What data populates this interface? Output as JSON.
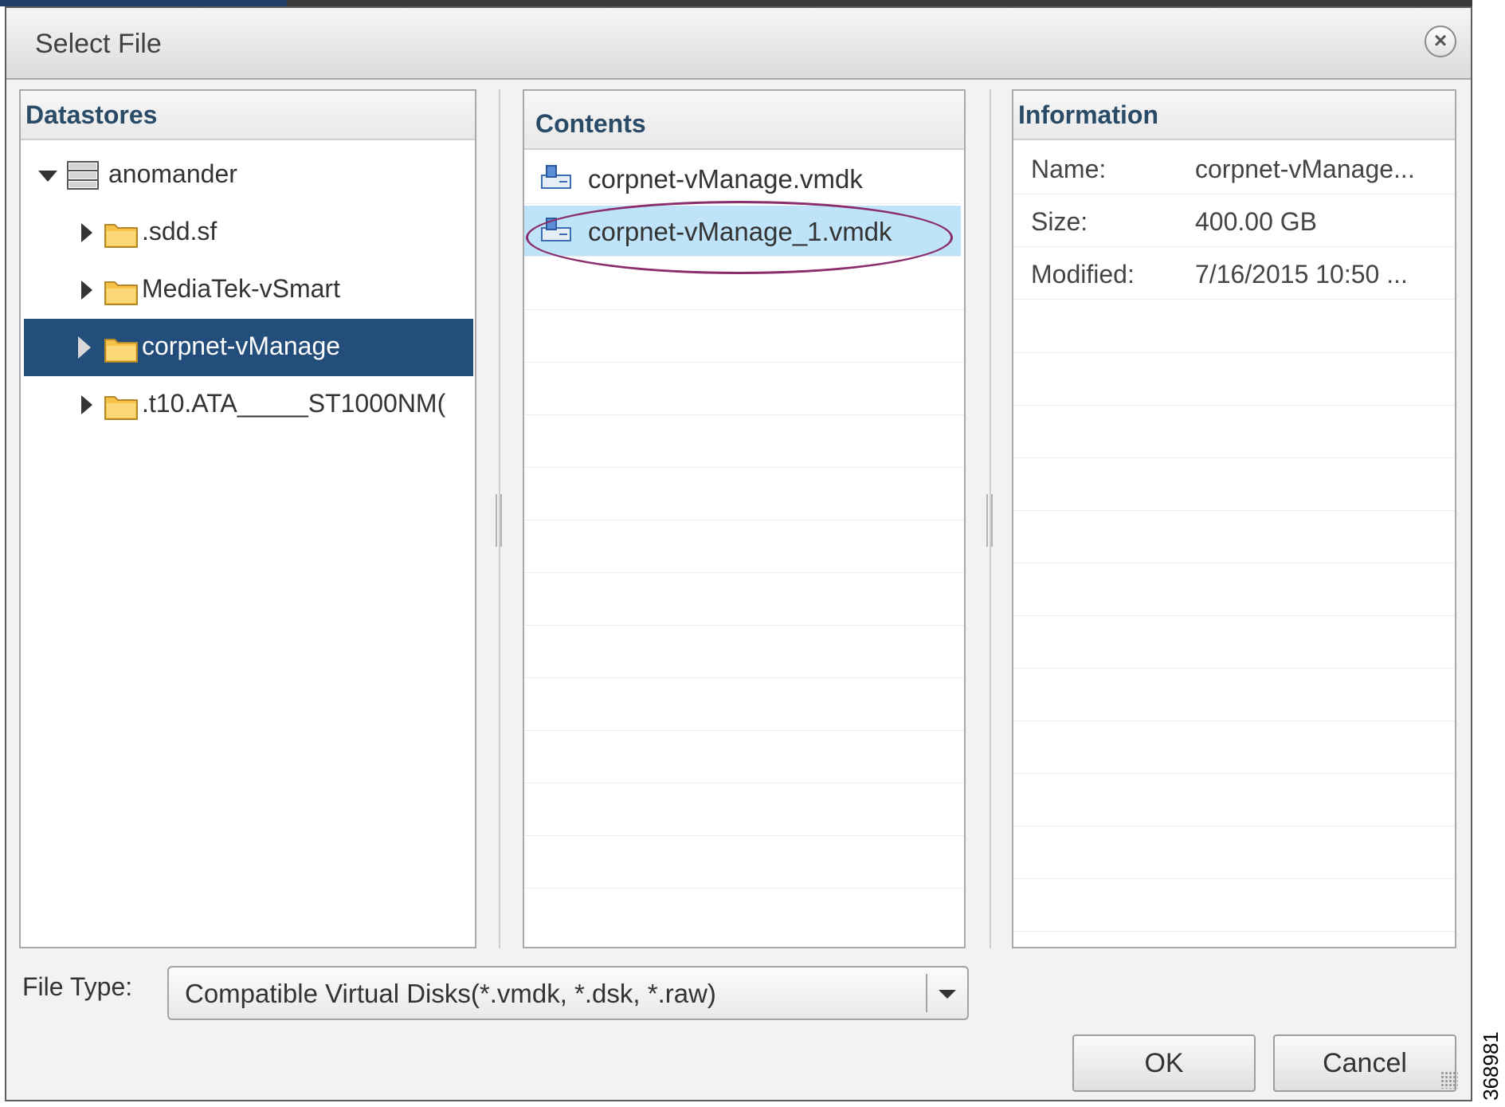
{
  "dialog": {
    "title": "Select File"
  },
  "datastores": {
    "header": "Datastores",
    "root": {
      "label": "anomander",
      "expanded": true
    },
    "folders": [
      {
        "label": ".sdd.sf",
        "selected": false
      },
      {
        "label": "MediaTek-vSmart",
        "selected": false
      },
      {
        "label": "corpnet-vManage",
        "selected": true
      },
      {
        "label": ".t10.ATA_____ST1000NM(",
        "selected": false
      }
    ]
  },
  "contents": {
    "header": "Contents",
    "files": [
      {
        "label": "corpnet-vManage.vmdk",
        "selected": false,
        "icon": "virtual-disk-icon"
      },
      {
        "label": "corpnet-vManage_1.vmdk",
        "selected": true,
        "icon": "virtual-disk-icon"
      }
    ]
  },
  "information": {
    "header": "Information",
    "rows": [
      {
        "key": "Name:",
        "value": "corpnet-vManage..."
      },
      {
        "key": "Size:",
        "value": "400.00 GB"
      },
      {
        "key": "Modified:",
        "value": "7/16/2015 10:50 ..."
      }
    ]
  },
  "file_type": {
    "label": "File Type:",
    "selected": "Compatible Virtual Disks(*.vmdk, *.dsk, *.raw)"
  },
  "buttons": {
    "ok": "OK",
    "cancel": "Cancel"
  },
  "figure_number": "368981",
  "colors": {
    "selection_tree": "#234d7a",
    "selection_list": "#bfe3f8",
    "header_text": "#2a4b68",
    "highlight_oval": "#8b2c6b",
    "folder": "#f6c24a"
  }
}
